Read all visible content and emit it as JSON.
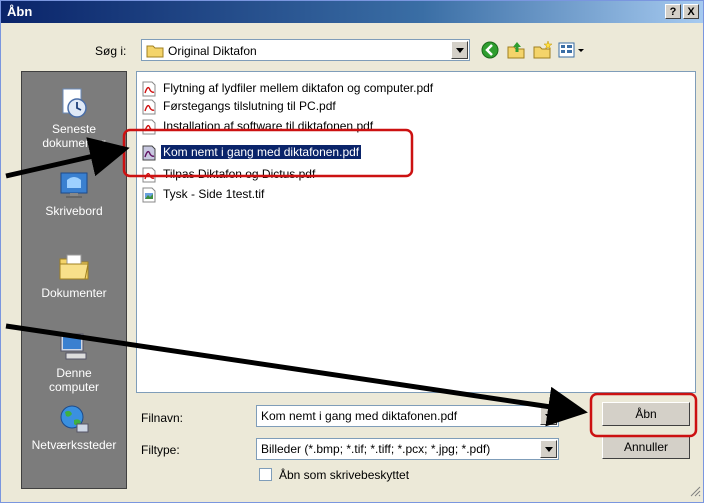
{
  "window": {
    "title": "Åbn",
    "help_label": "?",
    "close_label": "X"
  },
  "lookin": {
    "label": "Søg i:",
    "value": "Original Diktafon"
  },
  "places": [
    {
      "label": "Seneste\ndokumenter",
      "icon": "recent-documents-icon"
    },
    {
      "label": "Skrivebord",
      "icon": "desktop-icon"
    },
    {
      "label": "Dokumenter",
      "icon": "documents-folder-icon"
    },
    {
      "label": "Denne\ncomputer",
      "icon": "my-computer-icon"
    },
    {
      "label": "Netværkssteder",
      "icon": "network-places-icon"
    }
  ],
  "files": [
    {
      "name": "Flytning af lydfiler mellem diktafon og computer.pdf",
      "type": "pdf"
    },
    {
      "name": "Førstegangs tilslutning til PC.pdf",
      "type": "pdf"
    },
    {
      "name": "Installation af software til diktafonen.pdf",
      "type": "pdf"
    },
    {
      "name": "Kom nemt i gang med diktafonen.pdf",
      "type": "pdf",
      "selected": true
    },
    {
      "name": "Tilpas Diktafon og Dictus.pdf",
      "type": "pdf"
    },
    {
      "name": "Tysk - Side 1test.tif",
      "type": "tif"
    }
  ],
  "filename": {
    "label": "Filnavn:",
    "value": "Kom nemt i gang med diktafonen.pdf"
  },
  "filetype": {
    "label": "Filtype:",
    "value": "Billeder (*.bmp; *.tif; *.tiff; *.pcx; *.jpg; *.pdf)"
  },
  "readonly": {
    "label": "Åbn som skrivebeskyttet"
  },
  "buttons": {
    "open": "Åbn",
    "cancel": "Annuller"
  },
  "colors": {
    "annotation": "#cc1111",
    "selection": "#0a246a",
    "places_bg": "#7c7c7c"
  }
}
